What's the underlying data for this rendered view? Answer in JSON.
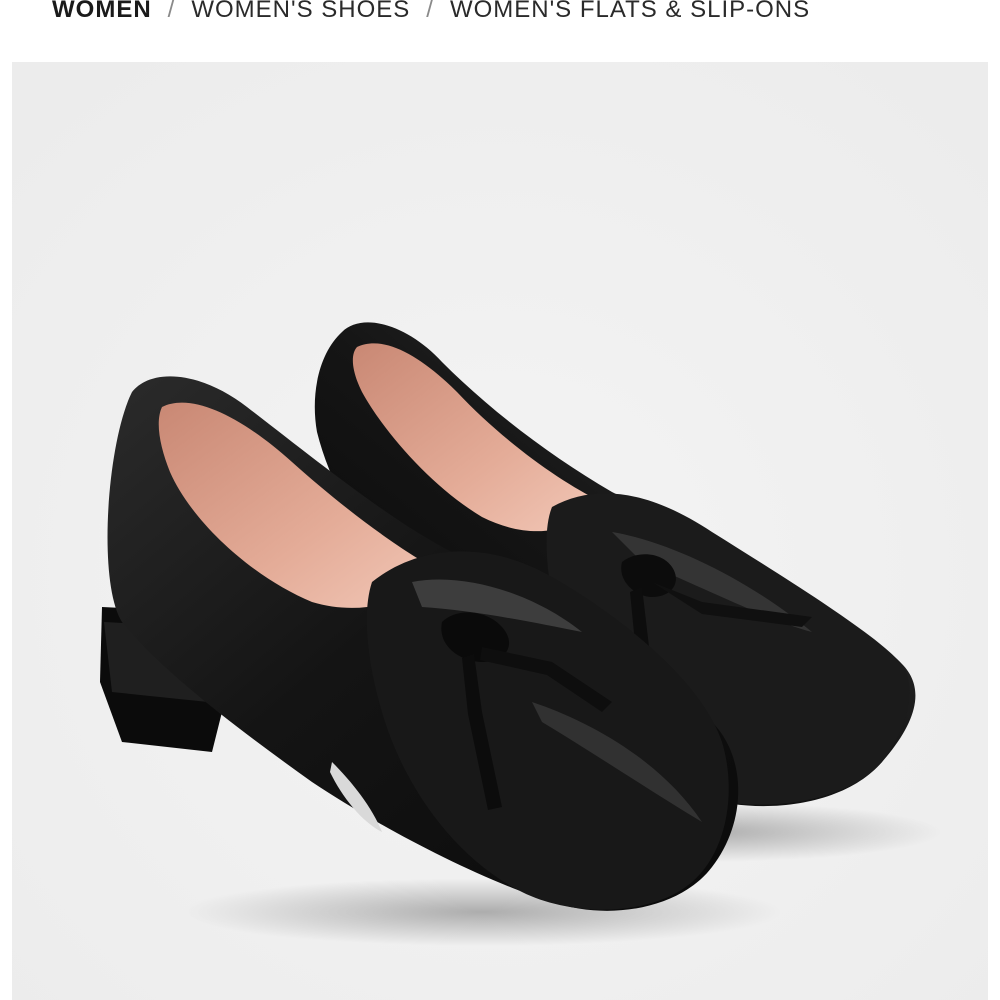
{
  "breadcrumb": {
    "items": [
      "WOMEN",
      "WOMEN'S SHOES",
      "WOMEN'S FLATS & SLIP-ONS"
    ],
    "separator": "/"
  },
  "product_image": {
    "subject": "black leather pointed-toe loafers with bow detail",
    "background_color": "#f0f0f0",
    "leather_color": "#141414",
    "lining_color": "#e2a692"
  }
}
